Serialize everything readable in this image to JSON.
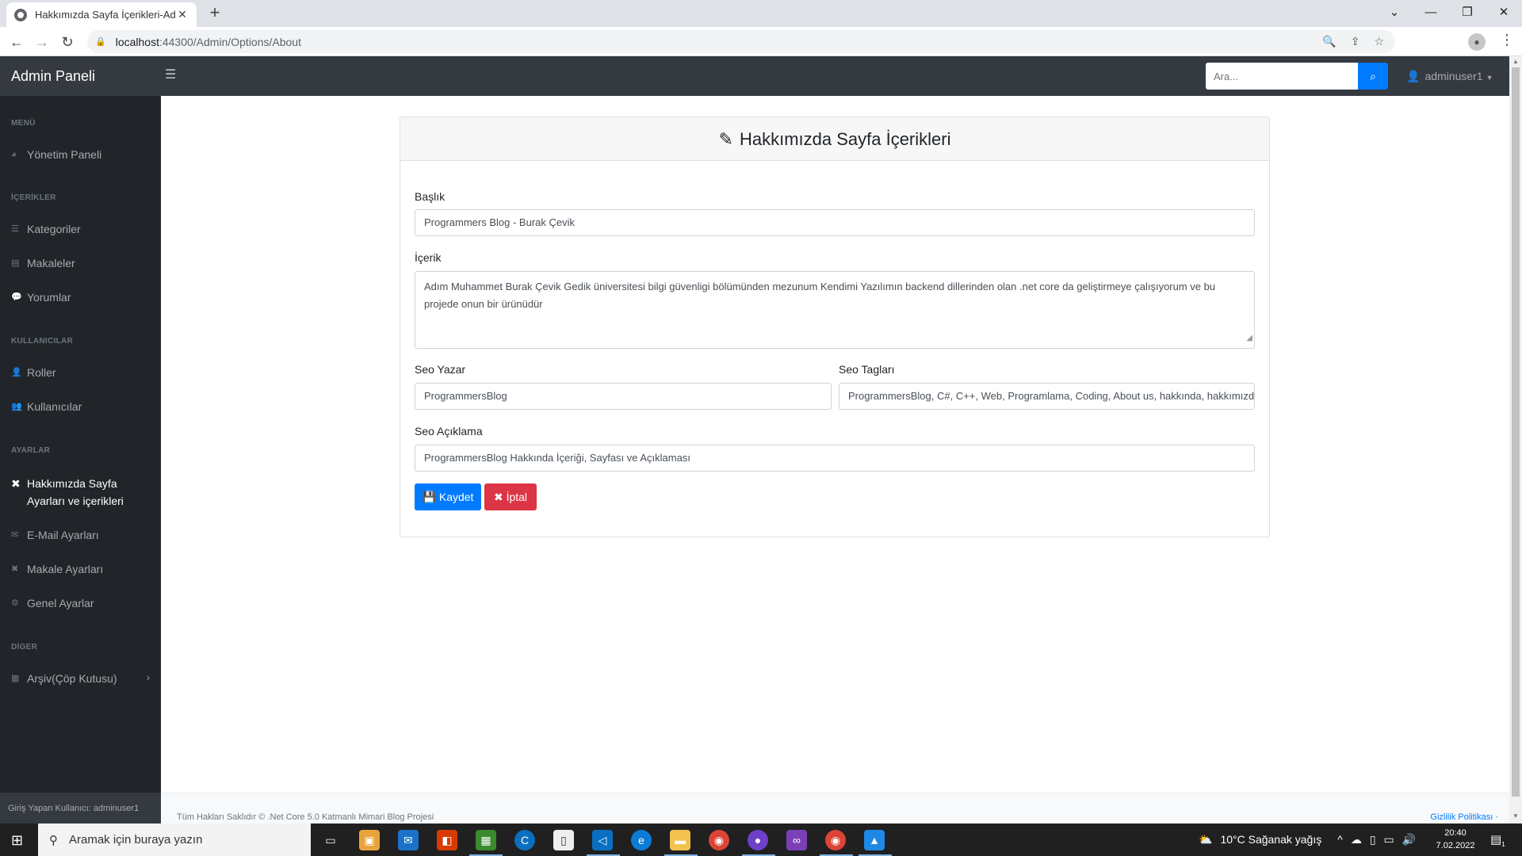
{
  "browser": {
    "tab_title": "Hakkımızda Sayfa İçerikleri-Admin",
    "url_host": "localhost",
    "url_path": ":44300/Admin/Options/About"
  },
  "navbar": {
    "brand": "Admin Paneli",
    "search_placeholder": "Ara...",
    "user": "adminuser1"
  },
  "sidebar": {
    "headings": [
      "MENÜ",
      "İÇERİKLER",
      "KULLANICILAR",
      "AYARLAR",
      "DİGER"
    ],
    "items": [
      {
        "label": "Yönetim Paneli",
        "icon": "dashboard-icon"
      },
      {
        "label": "Kategoriler",
        "icon": "list-icon"
      },
      {
        "label": "Makaleler",
        "icon": "file-icon"
      },
      {
        "label": "Yorumlar",
        "icon": "comments-icon"
      },
      {
        "label": "Roller",
        "icon": "user-tag-icon"
      },
      {
        "label": "Kullanıcılar",
        "icon": "users-icon"
      },
      {
        "label": "Hakkımızda Sayfa Ayarları ve içerikleri",
        "icon": "tools-icon",
        "active": true
      },
      {
        "label": "E-Mail Ayarları",
        "icon": "envelope-icon"
      },
      {
        "label": "Makale Ayarları",
        "icon": "tools-icon"
      },
      {
        "label": "Genel Ayarlar",
        "icon": "cog-icon"
      },
      {
        "label": "Arşiv(Çöp Kutusu)",
        "icon": "archive-icon"
      }
    ],
    "footer": "Giriş Yapan Kullanıcı: adminuser1"
  },
  "card": {
    "title": "Hakkımızda Sayfa İçerikleri",
    "fields": {
      "baslik_label": "Başlık",
      "baslik_value": "Programmers Blog - Burak Çevik",
      "icerik_label": "İçerik",
      "icerik_value": "Adım Muhammet  Burak Çevik Gedik üniversitesi bilgi güvenligi bölümünden mezunum Kendimi Yazılımın backend dillerinden olan .net core da geliştirmeye çalışıyorum ve bu projede onun bir ürünüdür",
      "seo_yazar_label": "Seo Yazar",
      "seo_yazar_value": "ProgrammersBlog",
      "seo_taglari_label": "Seo Tagları",
      "seo_taglari_value": "ProgrammersBlog, C#, C++, Web, Programlama, Coding, About us, hakkında, hakkımızda",
      "seo_aciklama_label": "Seo Açıklama",
      "seo_aciklama_value": "ProgrammersBlog Hakkında İçeriği, Sayfası ve Açıklaması"
    },
    "save_label": "Kaydet",
    "cancel_label": "İptal"
  },
  "footer": {
    "left": "Tüm Hakları Saklıdır © .Net Core 5.0 Katmanlı Mimari Blog Projesi",
    "right": "Gizlilik Politikası ·"
  },
  "taskbar": {
    "search_placeholder": "Aramak için buraya yazın",
    "weather": "10°C  Sağanak yağış",
    "time": "20:40",
    "date": "7.02.2022",
    "notification_count": "1"
  },
  "colors": {
    "primary": "#007bff",
    "danger": "#dc3545",
    "navbar": "#343a40",
    "sidebar": "#212529"
  }
}
